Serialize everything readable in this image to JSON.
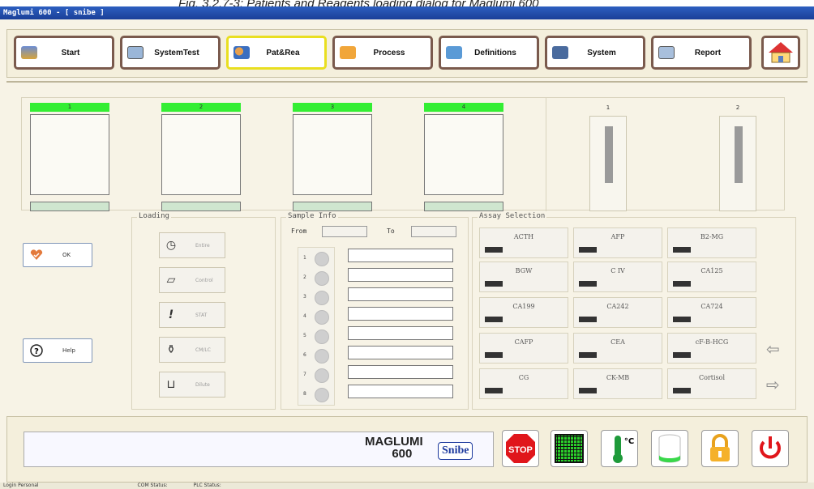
{
  "caption": "Fig. 3.2.7-3: Patients and Reagents loading dialog for Maglumi 600",
  "window": {
    "title": "Maglumi 600 - [ snibe ]"
  },
  "nav": {
    "items": [
      {
        "label": "Start"
      },
      {
        "label": "SystemTest"
      },
      {
        "label": "Pat&Rea"
      },
      {
        "label": "Process"
      },
      {
        "label": "Definitions"
      },
      {
        "label": "System"
      },
      {
        "label": "Report"
      }
    ],
    "active": "Pat&Rea"
  },
  "racks": {
    "sample_racks": [
      "1",
      "2",
      "3",
      "4"
    ],
    "reagent_racks": [
      "1",
      "2"
    ]
  },
  "side_buttons": {
    "ok": "OK",
    "help": "Help"
  },
  "loading": {
    "title": "Loading",
    "buttons": [
      "Entire",
      "Control",
      "STAT",
      "CM/LC",
      "Dilute"
    ]
  },
  "sample_info": {
    "title": "Sample Info",
    "from_label": "From",
    "to_label": "To",
    "slots": [
      "1",
      "2",
      "3",
      "4",
      "5",
      "6",
      "7",
      "8"
    ]
  },
  "assay_selection": {
    "title": "Assay Selection",
    "assays": [
      "ACTH",
      "AFP",
      "B2-MG",
      "BGW",
      "C IV",
      "CA125",
      "CA199",
      "CA242",
      "CA724",
      "CAFP",
      "CEA",
      "cF-B-HCG",
      "CG",
      "CK-MB",
      "Cortisol"
    ]
  },
  "brand": {
    "name": "MAGLUMI",
    "model": "600",
    "logo": "Snibe"
  },
  "tools": {
    "stop": "STOP",
    "temp_unit": "°C"
  },
  "statusbar": {
    "left": "Login Personal",
    "com": "COM Status:",
    "plc": "PLC Status:"
  },
  "colors": {
    "accent_active": "#e9df20",
    "rack_header": "#33ee33",
    "stop": "#e0161b",
    "power": "#e0161b"
  }
}
